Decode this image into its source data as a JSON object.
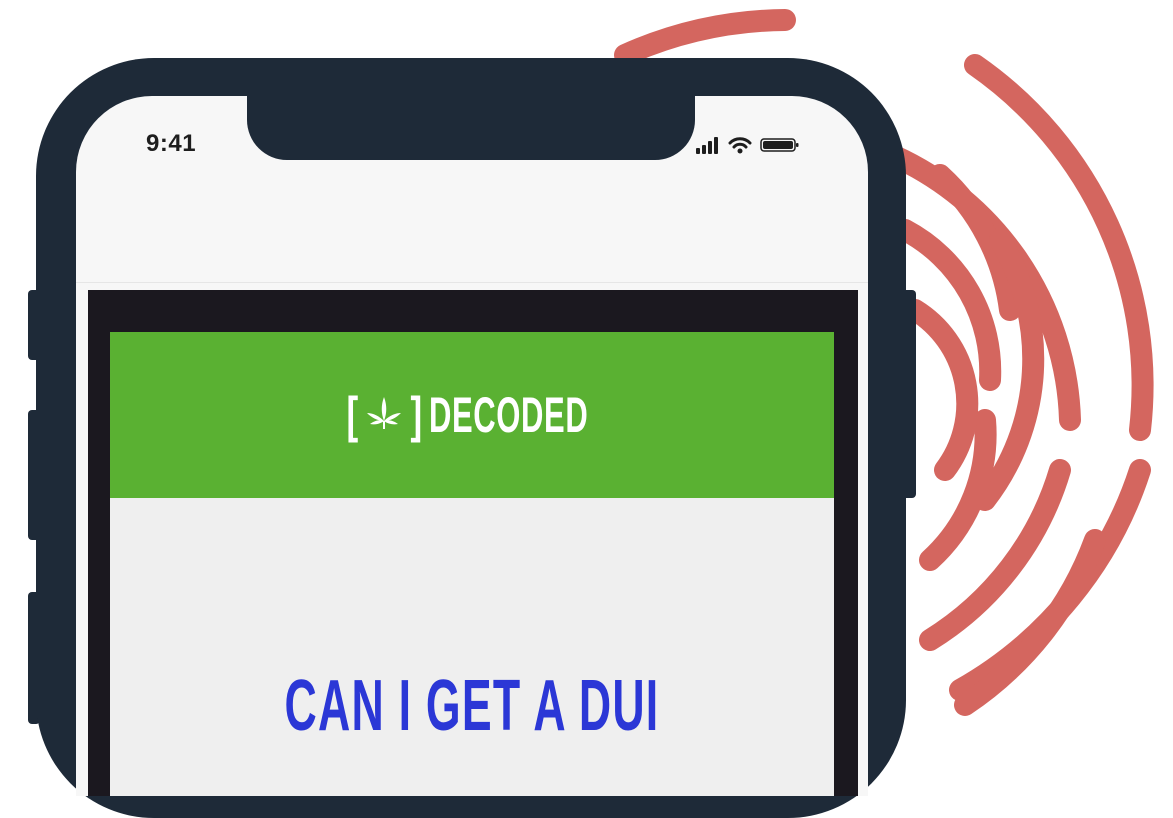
{
  "status_bar": {
    "time": "9:41",
    "icons": [
      "signal-bars-icon",
      "wifi-icon",
      "battery-icon"
    ]
  },
  "site": {
    "brand": "DECODED",
    "logo_icon": "cannabis-leaf-icon",
    "headline": "CAN I GET A DUI"
  },
  "colors": {
    "phone_frame": "#1e2a38",
    "header_green": "#5ab132",
    "headline_blue": "#2b37d6",
    "fingerprint": "#d4665f"
  }
}
